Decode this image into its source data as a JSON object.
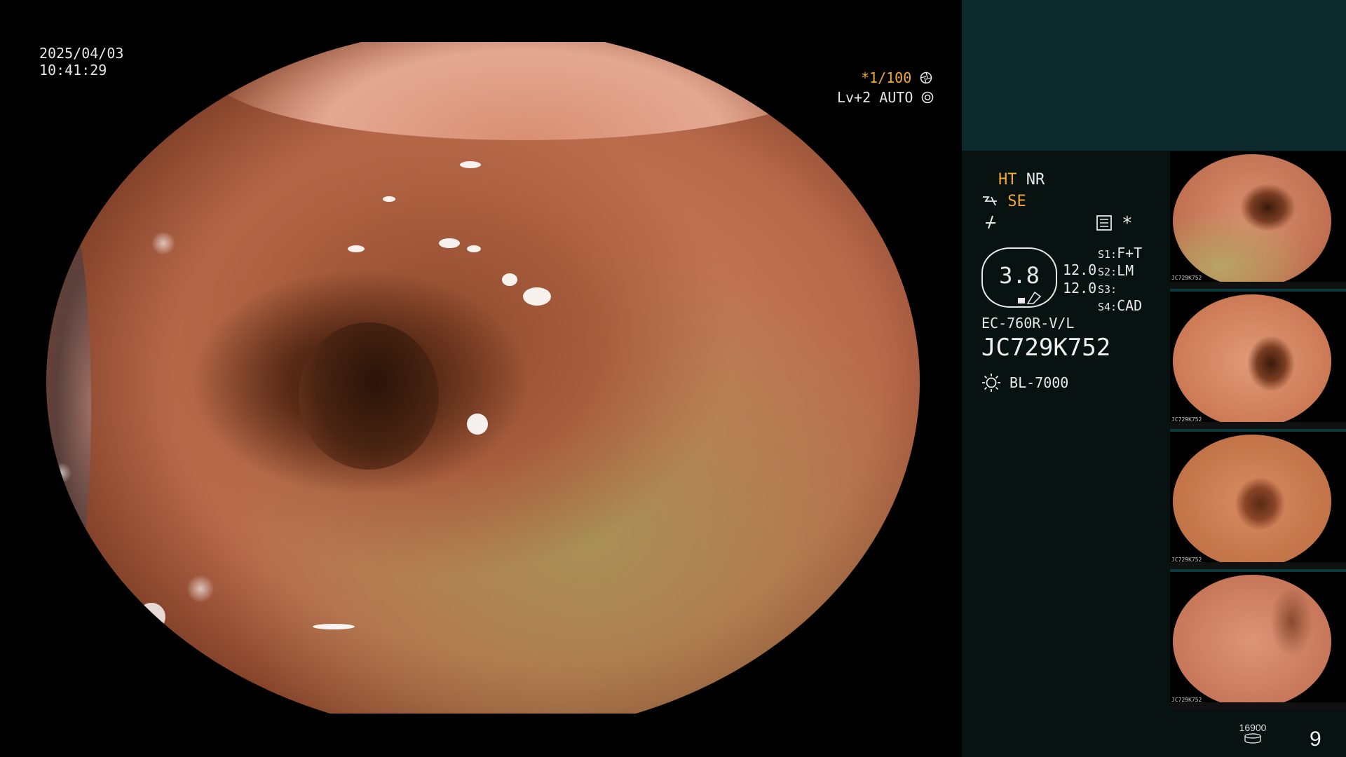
{
  "overlay": {
    "date": "2025/04/03",
    "time": "10:41:29",
    "shutter": "*1/100",
    "shutter_icon": "aperture-icon",
    "iris": "Lv+2 AUTO",
    "iris_icon": "iris-icon"
  },
  "panel": {
    "ht_label": "HT",
    "nr_label": "NR",
    "se_label": "SE",
    "se_icon": "structure-enhance-icon",
    "color_icon": "color-mode-icon",
    "settings_icon": "menu-list-icon",
    "asterisk": "*",
    "brightness_value": "3.8",
    "value_line_1": "12.0",
    "value_line_2": "12.0",
    "s1_label": "S1:",
    "s1_value": "F+T",
    "s2_label": "S2:",
    "s2_value": "LM",
    "s3_label": "S3:",
    "s3_value": "",
    "s4_label": "S4:",
    "s4_value": "CAD",
    "scope_model": "EC-760R-V/L",
    "scope_serial": "JC729K752",
    "light_icon": "light-source-icon",
    "light_source": "BL-7000",
    "storage_count": "16900",
    "storage_icon": "disk-icon",
    "image_count": "9"
  },
  "thumbnails": [
    {
      "id": "thumb-1",
      "serial": "JC729K752"
    },
    {
      "id": "thumb-2",
      "serial": "JC729K752"
    },
    {
      "id": "thumb-3",
      "serial": "JC729K752"
    },
    {
      "id": "thumb-4",
      "serial": "JC729K752"
    }
  ],
  "colors": {
    "accent_orange": "#f2a934",
    "panel_bg": "#081211",
    "panel_top_bg": "#0d2a2d"
  }
}
